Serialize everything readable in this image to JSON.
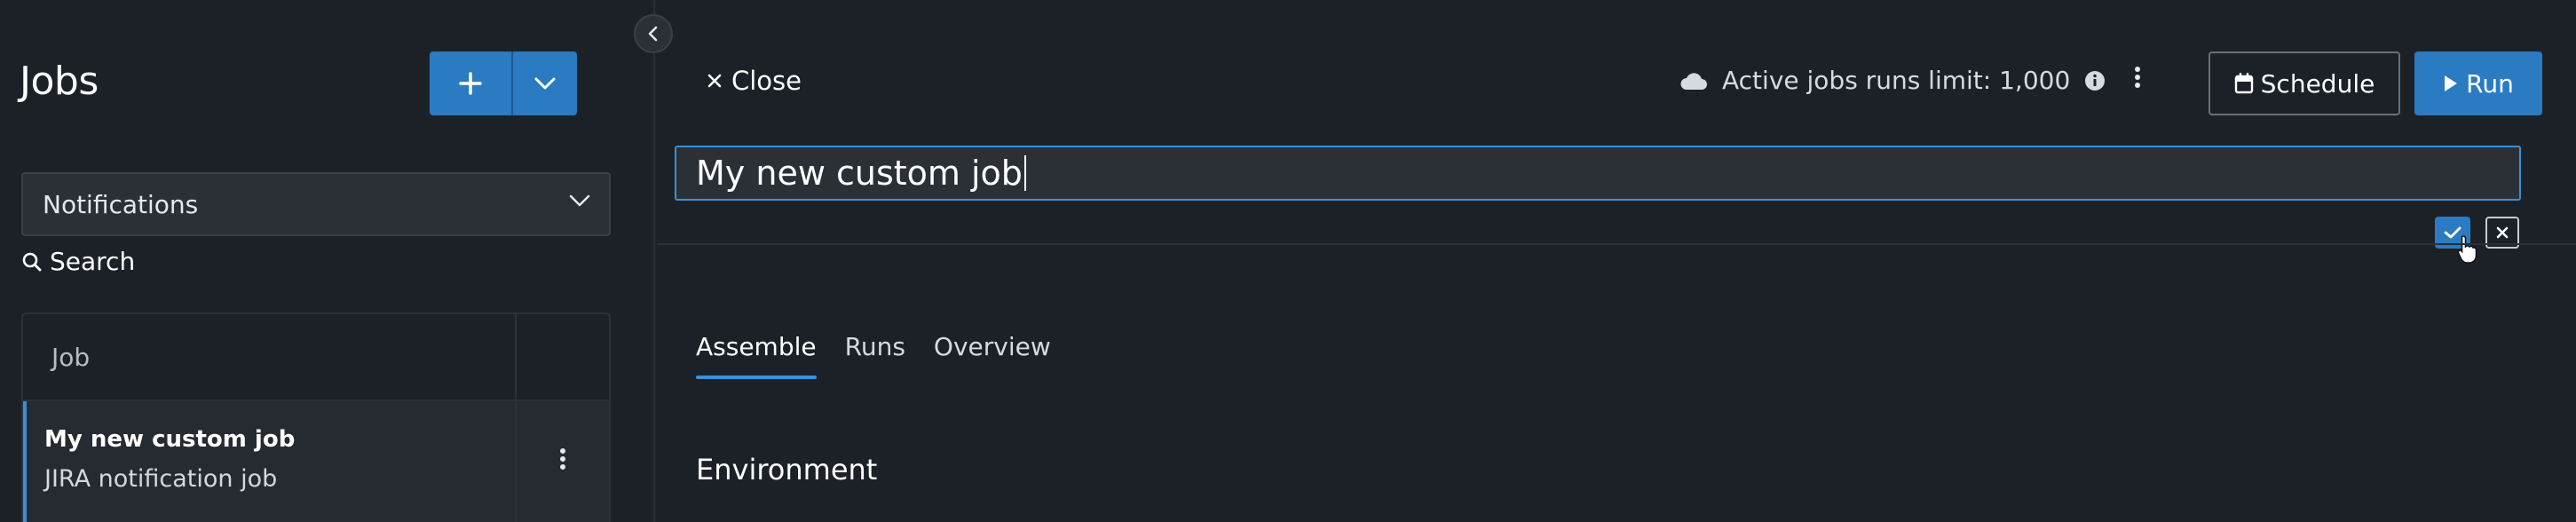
{
  "sidebar": {
    "title": "Jobs",
    "filter_value": "Notifications",
    "search_label": "Search",
    "table": {
      "column_header": "Job",
      "rows": [
        {
          "title": "My new custom job",
          "subtitle": "JIRA notification job"
        }
      ]
    }
  },
  "header": {
    "close_label": "Close",
    "limit_text": "Active jobs runs limit: 1,000",
    "schedule_label": "Schedule",
    "run_label": "Run"
  },
  "editor": {
    "job_name_value": "My new custom job"
  },
  "tabs": [
    {
      "label": "Assemble",
      "active": true
    },
    {
      "label": "Runs",
      "active": false
    },
    {
      "label": "Overview",
      "active": false
    }
  ],
  "section": {
    "title": "Environment"
  },
  "colors": {
    "background": "#1c2128",
    "accent": "#2a7bc1",
    "active_tab_underline": "#3d8fd6"
  }
}
